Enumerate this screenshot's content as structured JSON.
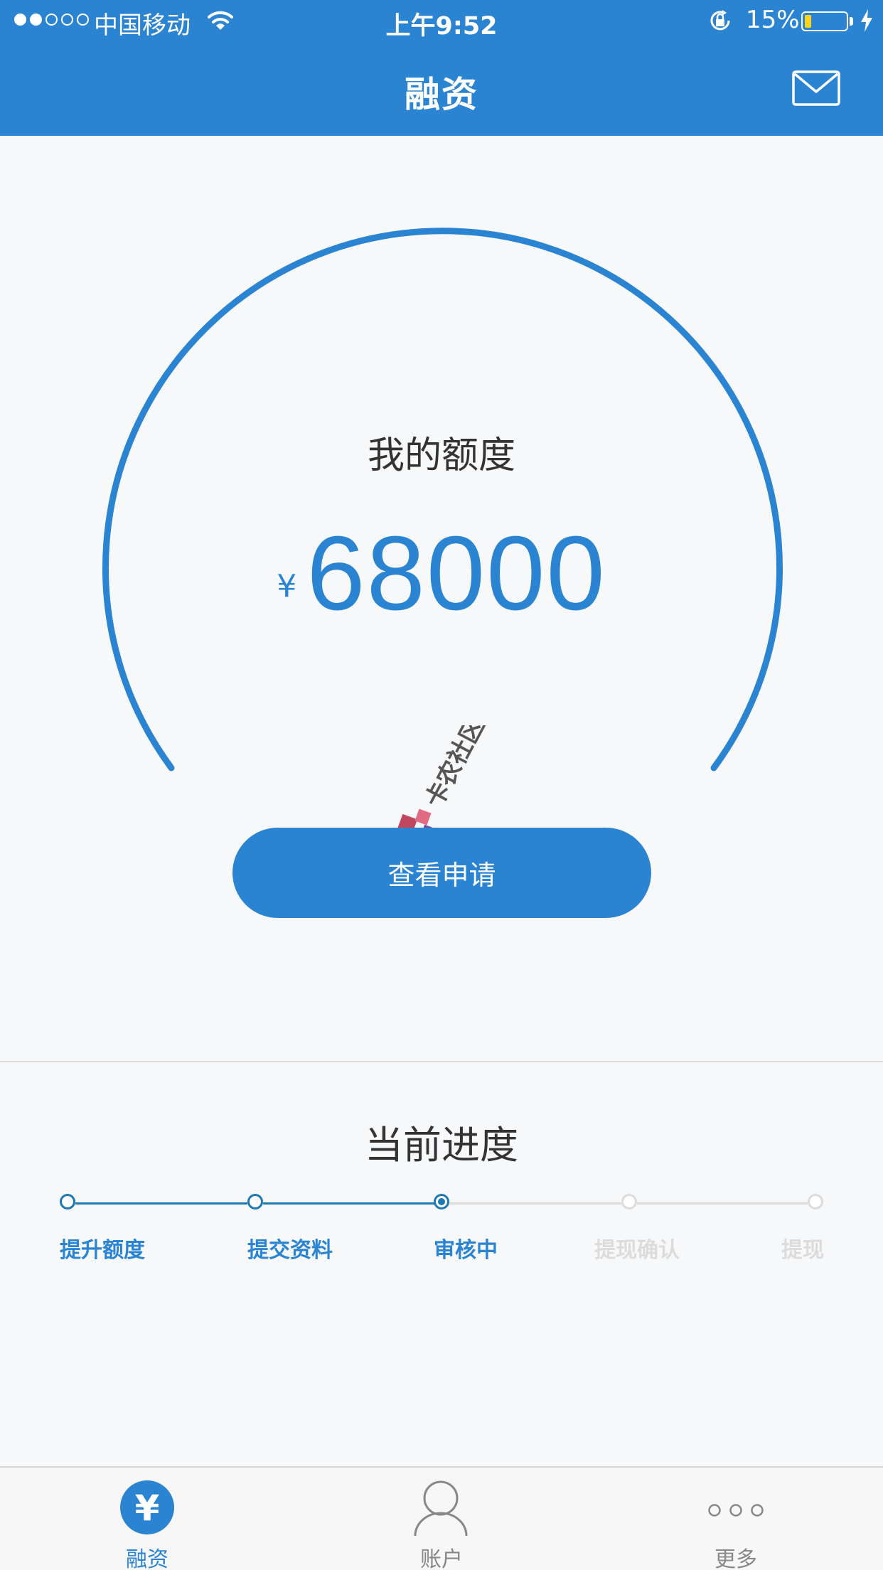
{
  "status_bar": {
    "signal_bars": [
      true,
      true,
      false,
      false,
      false
    ],
    "carrier": "中国移动",
    "time": "上午9:52",
    "battery_percent": "15%",
    "battery_level": 0.15,
    "battery_color": "#ffd21f"
  },
  "header": {
    "title": "融资",
    "mail_icon": "mail-icon",
    "background": "#2b84d2"
  },
  "credit": {
    "label": "我的额度",
    "currency": "¥",
    "amount": "68000",
    "accent": "#2b84d2"
  },
  "apply_button": {
    "label": "查看申请"
  },
  "watermark": {
    "text": "卡农社区"
  },
  "progress": {
    "title": "当前进度",
    "current_index": 2,
    "steps": [
      {
        "label": "提升额度",
        "state": "done"
      },
      {
        "label": "提交资料",
        "state": "done"
      },
      {
        "label": "审核中",
        "state": "current"
      },
      {
        "label": "提现确认",
        "state": "todo"
      },
      {
        "label": "提现",
        "state": "todo"
      }
    ],
    "done_color": "#1e78b4",
    "todo_color": "#dcdcdc"
  },
  "tabbar": {
    "tabs": [
      {
        "label": "融资",
        "icon": "yen-icon",
        "active": true
      },
      {
        "label": "账户",
        "icon": "user-icon",
        "active": false
      },
      {
        "label": "更多",
        "icon": "more-icon",
        "active": false
      }
    ]
  }
}
